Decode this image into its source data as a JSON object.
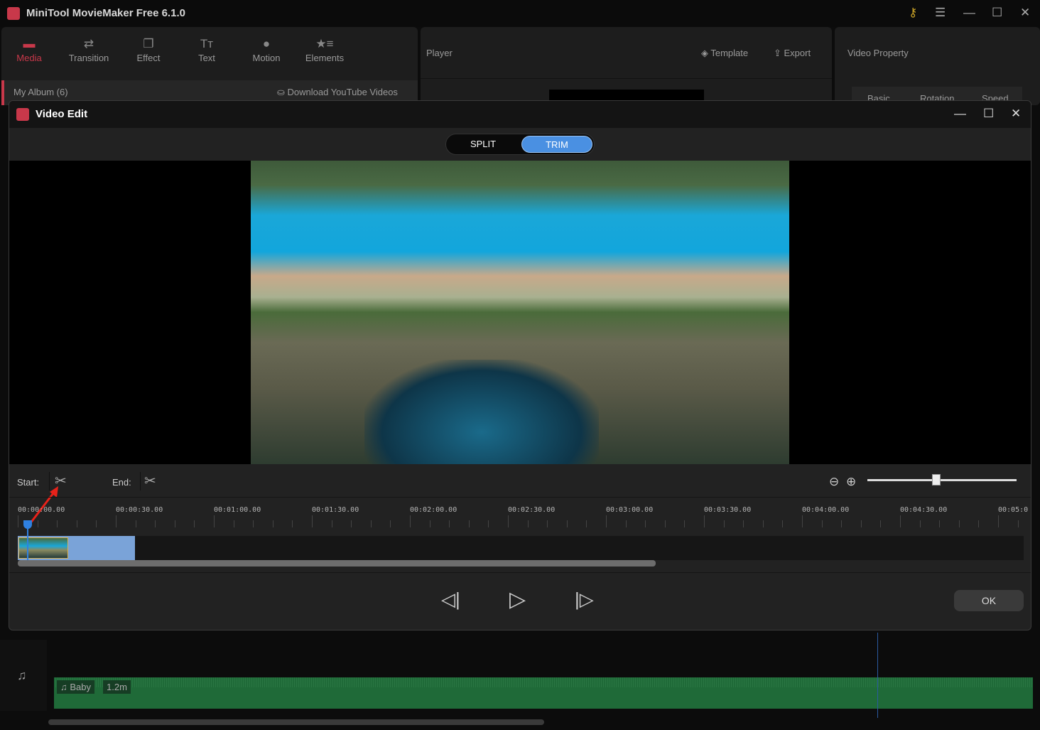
{
  "app": {
    "title": "MiniTool MovieMaker Free 6.1.0",
    "accent": "#c8384a"
  },
  "toolbar": [
    {
      "label": "Media",
      "icon": "folder-icon",
      "active": true
    },
    {
      "label": "Transition",
      "icon": "swap-arrows-icon"
    },
    {
      "label": "Effect",
      "icon": "layers-icon"
    },
    {
      "label": "Text",
      "icon": "text-icon"
    },
    {
      "label": "Motion",
      "icon": "motion-icon"
    },
    {
      "label": "Elements",
      "icon": "star-list-icon"
    }
  ],
  "media": {
    "album": "My Album (6)",
    "download": "Download YouTube Videos"
  },
  "player": {
    "label": "Player",
    "template": "Template",
    "export": "Export"
  },
  "property": {
    "label": "Video Property",
    "tabs": [
      "Basic",
      "Rotation",
      "Speed"
    ]
  },
  "dialog": {
    "title": "Video Edit",
    "split": "SPLIT",
    "trim": "TRIM",
    "active_mode": "TRIM",
    "start_label": "Start:",
    "end_label": "End:",
    "ok": "OK",
    "zoom_level": 0.46,
    "ruler": [
      "00:00:00.00",
      "00:00:30.00",
      "00:01:00.00",
      "00:01:30.00",
      "00:02:00.00",
      "00:02:30.00",
      "00:03:00.00",
      "00:03:30.00",
      "00:04:00.00",
      "00:04:30.00",
      "00:05:0"
    ]
  },
  "audio": {
    "name": "Baby",
    "duration": "1.2m"
  }
}
